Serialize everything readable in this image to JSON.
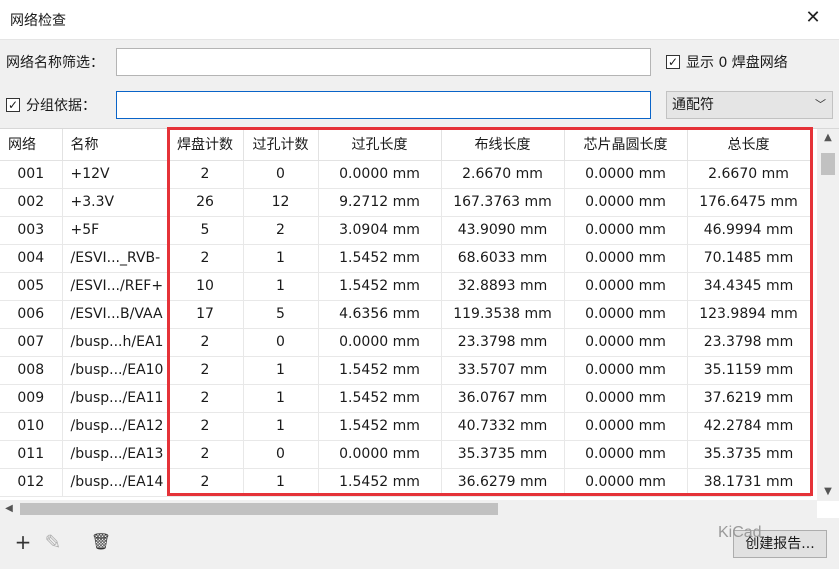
{
  "window": {
    "title": "网络检查",
    "close_glyph": "✕"
  },
  "filters": {
    "net_name_label": "网络名称筛选：",
    "net_name_value": "",
    "show_zero_pad_label": "显示 0 焊盘网络",
    "show_zero_pad_checked": true,
    "group_by_label": "分组依据：",
    "group_by_checked": true,
    "group_by_value": "",
    "match_mode_value": "通配符"
  },
  "table": {
    "columns": [
      "网络",
      "名称",
      "焊盘计数",
      "过孔计数",
      "过孔长度",
      "布线长度",
      "芯片晶圆长度",
      "总长度"
    ],
    "rows": [
      [
        "001",
        "+12V",
        "2",
        "0",
        "0.0000 mm",
        "2.6670 mm",
        "0.0000 mm",
        "2.6670 mm"
      ],
      [
        "002",
        "+3.3V",
        "26",
        "12",
        "9.2712 mm",
        "167.3763 mm",
        "0.0000 mm",
        "176.6475 mm"
      ],
      [
        "003",
        "+5F",
        "5",
        "2",
        "3.0904 mm",
        "43.9090 mm",
        "0.0000 mm",
        "46.9994 mm"
      ],
      [
        "004",
        "/ESVI..._RVB-",
        "2",
        "1",
        "1.5452 mm",
        "68.6033 mm",
        "0.0000 mm",
        "70.1485 mm"
      ],
      [
        "005",
        "/ESVI.../REF+",
        "10",
        "1",
        "1.5452 mm",
        "32.8893 mm",
        "0.0000 mm",
        "34.4345 mm"
      ],
      [
        "006",
        "/ESVI...B/VAA",
        "17",
        "5",
        "4.6356 mm",
        "119.3538 mm",
        "0.0000 mm",
        "123.9894 mm"
      ],
      [
        "007",
        "/busp...h/EA1",
        "2",
        "0",
        "0.0000 mm",
        "23.3798 mm",
        "0.0000 mm",
        "23.3798 mm"
      ],
      [
        "008",
        "/busp.../EA10",
        "2",
        "1",
        "1.5452 mm",
        "33.5707 mm",
        "0.0000 mm",
        "35.1159 mm"
      ],
      [
        "009",
        "/busp.../EA11",
        "2",
        "1",
        "1.5452 mm",
        "36.0767 mm",
        "0.0000 mm",
        "37.6219 mm"
      ],
      [
        "010",
        "/busp.../EA12",
        "2",
        "1",
        "1.5452 mm",
        "40.7332 mm",
        "0.0000 mm",
        "42.2784 mm"
      ],
      [
        "011",
        "/busp.../EA13",
        "2",
        "0",
        "0.0000 mm",
        "35.3735 mm",
        "0.0000 mm",
        "35.3735 mm"
      ],
      [
        "012",
        "/busp.../EA14",
        "2",
        "1",
        "1.5452 mm",
        "36.6279 mm",
        "0.0000 mm",
        "38.1731 mm"
      ]
    ]
  },
  "footer": {
    "add_icon_glyph": "+",
    "edit_icon_glyph": "✎",
    "delete_icon_glyph": "🗑",
    "report_button_label": "创建报告...",
    "watermark_text": "KiCad"
  },
  "colors": {
    "highlight_box": "#e53238",
    "focus_border": "#0a64c8"
  }
}
